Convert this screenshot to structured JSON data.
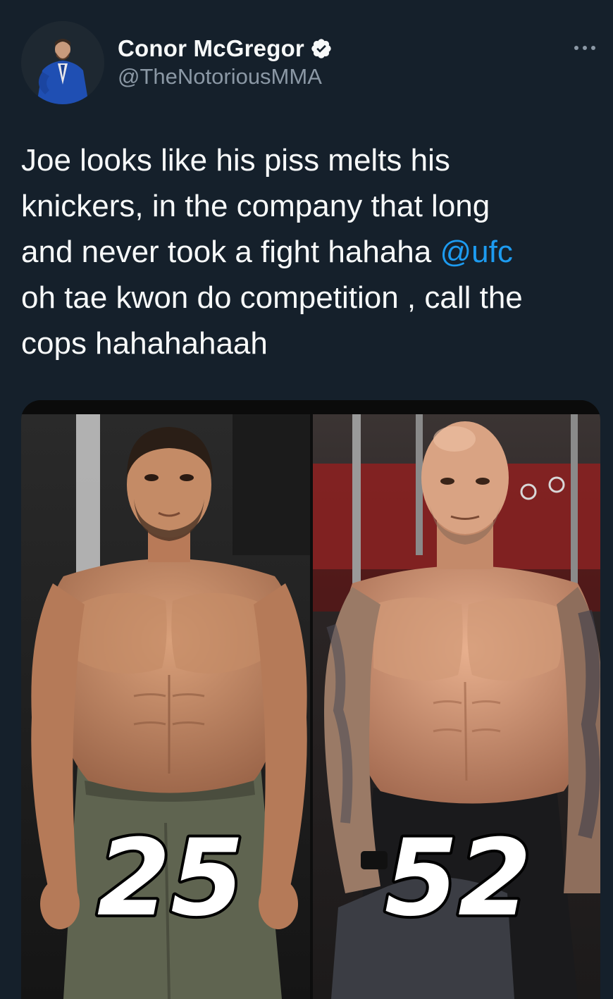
{
  "author": {
    "display_name": "Conor McGregor",
    "handle": "@TheNotoriousMMA",
    "verified": true,
    "avatar_icon": "profile-photo"
  },
  "tweet": {
    "text_before_mention": "Joe looks like his piss melts his\nknickers, in the company that long\nand never took a fight hahaha ",
    "mention": "@ufc",
    "text_after_mention": "\noh tae kwon do competition , call the\ncops hahahahaah"
  },
  "media": {
    "left_label": "25",
    "right_label": "52"
  },
  "colors": {
    "background": "#15202b",
    "text": "#f7f9f9",
    "secondary_text": "#8b98a5",
    "accent": "#1d9bf0"
  },
  "icons": {
    "verified": "verified-badge-icon",
    "more": "more-icon"
  }
}
